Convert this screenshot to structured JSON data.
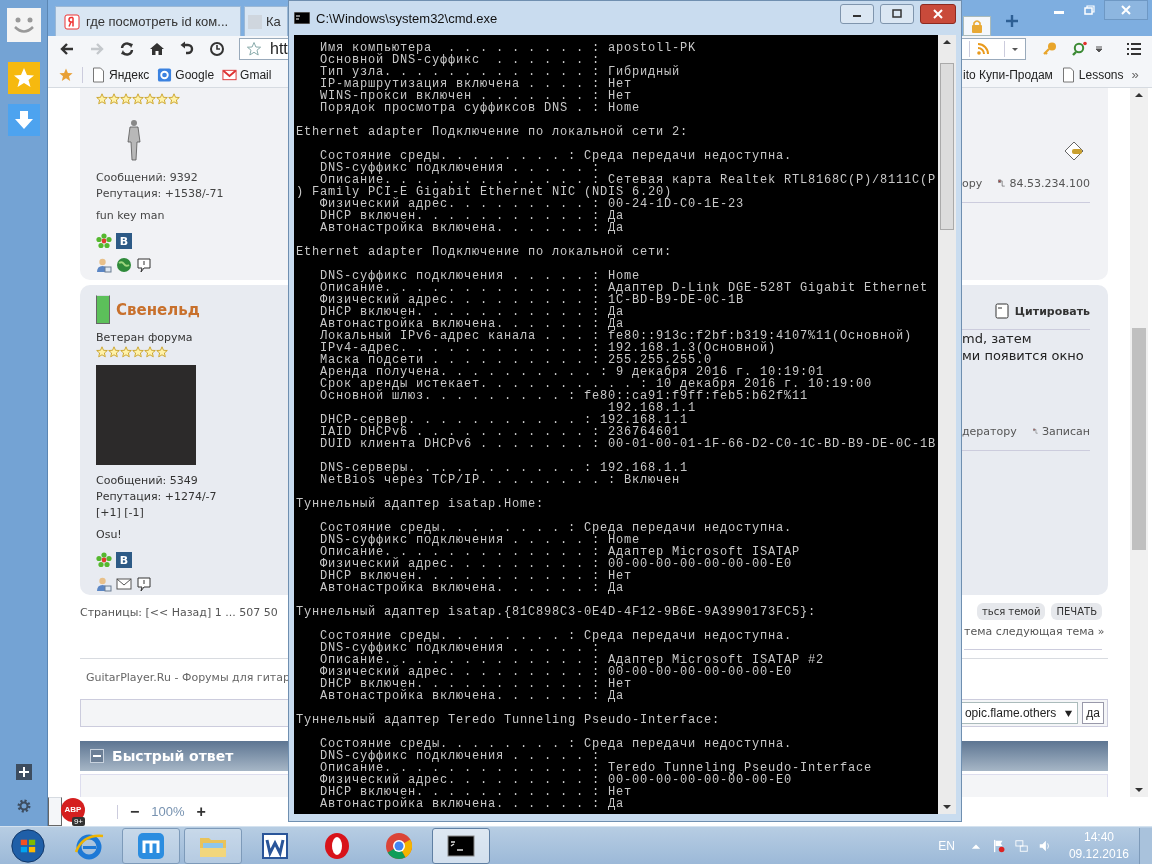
{
  "browser": {
    "tabs": [
      {
        "title": "где посмотреть id ком...",
        "kind": "yandex",
        "selected": false
      },
      {
        "title": "Ка",
        "kind": "letter",
        "selected": false
      },
      {
        "kind": "lock",
        "selected": true
      }
    ],
    "address": "htt",
    "bookmarks_left": [
      {
        "label": "Яндекс",
        "kind": "page"
      },
      {
        "label": "Google",
        "kind": "google"
      },
      {
        "label": "Gmail",
        "kind": "gmail"
      }
    ],
    "bookmarks_right": [
      {
        "label": "ito Купи-Продам",
        "kind": "text"
      },
      {
        "label": "Lessons",
        "kind": "page"
      }
    ],
    "bookmarks_more": "»",
    "posts": [
      {
        "stars": 7,
        "avatar": {
          "kind": "figure"
        },
        "stats": [
          "Сообщений: 9392",
          "Репутация: +1538/-71"
        ],
        "signature": "fun key man",
        "contacts": [
          [
            {
              "kind": "icq"
            },
            {
              "kind": "vk",
              "label": "В"
            }
          ],
          [
            {
              "kind": "profile"
            },
            {
              "kind": "www"
            },
            {
              "kind": "pm"
            }
          ]
        ],
        "karma_icon": true,
        "footer": {
          "link": "ору",
          "ip": "84.53.234.100"
        }
      },
      {
        "author": "Свенельд",
        "online": true,
        "rank": "Ветеран форума",
        "stars": 6,
        "avatar": {
          "kind": "photo"
        },
        "stats": [
          "Сообщений: 5349",
          "Репутация: +1274/-7",
          "[+1] [-1]"
        ],
        "signature": "Osu!",
        "contacts": [
          [
            {
              "kind": "icq"
            },
            {
              "kind": "vk",
              "label": "В"
            }
          ],
          [
            {
              "kind": "profile"
            },
            {
              "kind": "email"
            },
            {
              "kind": "pm"
            }
          ]
        ],
        "quote": "Цитировать",
        "right_lines": [
          "md, затем",
          "ми появится окно"
        ],
        "footer": {
          "link": "дератору",
          "ip": "Записан"
        }
      }
    ],
    "pagination": "Страницы: [<< Назад] 1 ... 507 50",
    "topic_buttons": [
      "ться темой",
      "ПЕЧАТЬ"
    ],
    "topic_nav": "тема следующая тема »",
    "footer": "GuitarPlayer.Ru - Форумы для гитар",
    "jump": {
      "value": "opic.flame.others",
      "button": "да"
    },
    "quick_reply": {
      "title": "Быстрый ответ",
      "expanded": true
    },
    "status_bar": {
      "adblock_label": "ABP",
      "adblock_badge": "9+",
      "zoom_out": "−",
      "zoom": "100%",
      "zoom_in": "+"
    }
  },
  "console": {
    "title": "C:\\Windows\\system32\\cmd.exe",
    "blocks": [
      [
        "   Имя компьютера  . . . . . . . . . : apostoll-PK",
        "   Основной DNS-суффикс  . . . . . . :",
        "   Тип узла. . . . . . . . . . . . . : Гибридный",
        "   IP-маршрутизация включена . . . . : Нет",
        "   WINS-прокси включен . . . . . . . : Нет",
        "   Порядок просмотра суффиксов DNS . : Home"
      ],
      [
        "Ethernet adapter Подключение по локальной сети 2:"
      ],
      [
        "   Состояние среды. . . . . . . . : Среда передачи недоступна.",
        "   DNS-суффикс подключения . . . . . :",
        "   Описание. . . . . . . . . . . . . : Сетевая карта Realtek RTL8168C(P)/8111C(P",
        ") Family PCI-E Gigabit Ethernet NIC (NDIS 6.20)",
        "   Физический адрес. . . . . . . . . : 00-24-1D-C0-1E-23",
        "   DHCP включен. . . . . . . . . . . : Да",
        "   Автонастройка включена. . . . . . : Да"
      ],
      [
        "Ethernet adapter Подключение по локальной сети:"
      ],
      [
        "   DNS-суффикс подключения . . . . . : Home",
        "   Описание. . . . . . . . . . . . . : Адаптер D-Link DGE-528T Gigabit Ethernet",
        "   Физический адрес. . . . . . . . . : 1C-BD-B9-DE-0C-1B",
        "   DHCP включен. . . . . . . . . . . : Да",
        "   Автонастройка включена. . . . . . : Да",
        "   Локальный IPv6-адрес канала . . . : fe80::913c:f2bf:b319:4107%11(Основной)",
        "   IPv4-адрес. . . . . . . . . . . . : 192.168.1.3(Основной)",
        "   Маска подсети . . . . . . . . . . : 255.255.255.0",
        "   Аренда получена. . . . . . . . . . : 9 декабря 2016 г. 10:19:01",
        "   Срок аренды истекает. . . . . . . . . . : 10 декабря 2016 г. 10:19:00",
        "   Основной шлюз. . . . . . . . . : fe80::ca91:f9ff:feb5:b62f%11",
        "                                       192.168.1.1",
        "   DHCP-сервер. . . . . . . . . . . : 192.168.1.1",
        "   IAID DHCPv6 . . . . . . . . . . . : 236764601",
        "   DUID клиента DHCPv6 . . . . . . . : 00-01-00-01-1F-66-D2-C0-1C-BD-B9-DE-0C-1B"
      ],
      [
        "   DNS-серверы. . . . . . . . . . . : 192.168.1.1",
        "   NetBios через TCP/IP. . . . . . . . : Включен"
      ],
      [
        "Туннельный адаптер isatap.Home:"
      ],
      [
        "   Состояние среды. . . . . . . . : Среда передачи недоступна.",
        "   DNS-суффикс подключения . . . . . : Home",
        "   Описание. . . . . . . . . . . . . : Адаптер Microsoft ISATAP",
        "   Физический адрес. . . . . . . . . : 00-00-00-00-00-00-00-E0",
        "   DHCP включен. . . . . . . . . . . : Нет",
        "   Автонастройка включена. . . . . . : Да"
      ],
      [
        "Туннельный адаптер isatap.{81C898C3-0E4D-4F12-9B6E-9A3990173FC5}:"
      ],
      [
        "   Состояние среды. . . . . . . . : Среда передачи недоступна.",
        "   DNS-суффикс подключения . . . . . :",
        "   Описание. . . . . . . . . . . . . : Адаптер Microsoft ISATAP #2",
        "   Физический адрес. . . . . . . . . : 00-00-00-00-00-00-00-E0",
        "   DHCP включен. . . . . . . . . . . : Нет",
        "   Автонастройка включена. . . . . . : Да"
      ],
      [
        "Туннельный адаптер Teredo Tunneling Pseudo-Interface:"
      ],
      [
        "   Состояние среды. . . . . . . . : Среда передачи недоступна.",
        "   DNS-суффикс подключения . . . . . :",
        "   Описание. . . . . . . . . . . . . : Teredo Tunneling Pseudo-Interface",
        "   Физический адрес. . . . . . . . . : 00-00-00-00-00-00-00-E0",
        "   DHCP включен. . . . . . . . . . . : Нет",
        "   Автонастройка включена. . . . . . : Да"
      ]
    ]
  },
  "taskbar": {
    "apps": [
      {
        "kind": "ie",
        "running": false,
        "active": false
      },
      {
        "kind": "maxthon",
        "running": true,
        "active": false
      },
      {
        "kind": "explorer",
        "running": true,
        "active": false
      },
      {
        "kind": "word",
        "running": false,
        "active": false
      },
      {
        "kind": "opera",
        "running": false,
        "active": false
      },
      {
        "kind": "chrome",
        "running": false,
        "active": false
      },
      {
        "kind": "cmd",
        "running": true,
        "active": true
      }
    ],
    "language": "EN",
    "time": "14:40",
    "date": "09.12.2016"
  }
}
